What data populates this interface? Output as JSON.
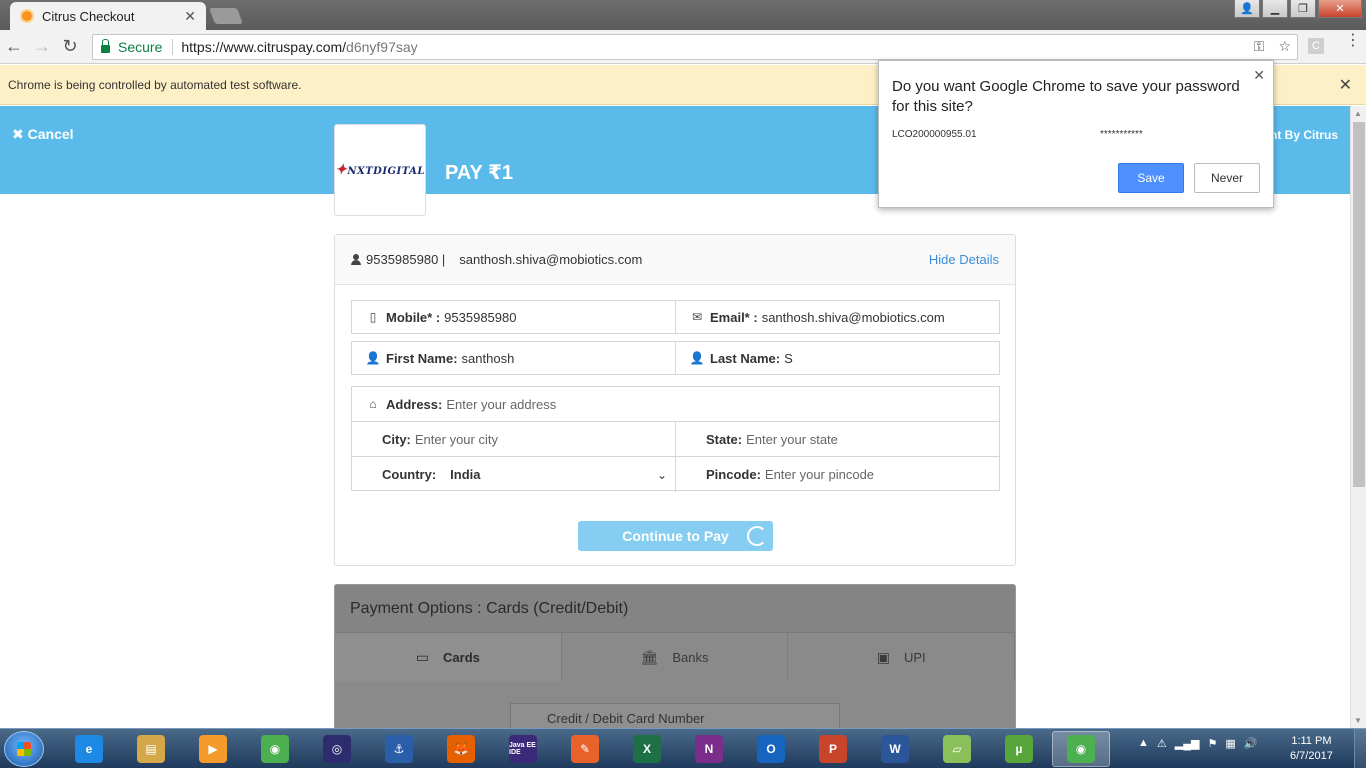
{
  "browser": {
    "tab_title": "Citrus Checkout",
    "tab_close": "✕",
    "secure_label": "Secure",
    "url_host": "https://www.citruspay.com/",
    "url_path": "d6nyf97say",
    "infobar_text": "Chrome is being controlled by automated test software.",
    "infobar_close": "✕",
    "ext_letter": "C"
  },
  "page": {
    "cancel_label": "✖ Cancel",
    "payment_by": "ent By Citrus",
    "logo_brand": "NXTDIGITAL",
    "pay_amount": "PAY ₹1"
  },
  "details": {
    "phone_head": "9535985980 |",
    "email_head": "santhosh.shiva@mobiotics.com",
    "hide_details": "Hide Details",
    "mobile_label": "Mobile* :",
    "mobile_value": "9535985980",
    "email_label": "Email* :",
    "email_value": "santhosh.shiva@mobiotics.com",
    "first_name_label": "First Name:",
    "first_name_value": "santhosh",
    "last_name_label": "Last Name:",
    "last_name_value": "S",
    "address_label": "Address:",
    "address_placeholder": "Enter your address",
    "city_label": "City:",
    "city_placeholder": "Enter your city",
    "state_label": "State:",
    "state_placeholder": "Enter your state",
    "country_label": "Country:",
    "country_value": "India",
    "pincode_label": "Pincode:",
    "pincode_placeholder": "Enter your pincode",
    "continue_label": "Continue to Pay"
  },
  "payment_options": {
    "header": "Payment Options : Cards (Credit/Debit)",
    "tabs": [
      {
        "label": "Cards"
      },
      {
        "label": "Banks"
      },
      {
        "label": "UPI"
      }
    ],
    "card_number_placeholder": "Credit / Debit Card Number"
  },
  "password_popup": {
    "question": "Do you want Google Chrome to save your password for this site?",
    "username": "LCO200000955.01",
    "password": "***********",
    "save_label": "Save",
    "never_label": "Never"
  },
  "taskbar": {
    "items": [
      {
        "label": "e",
        "color": "#1e88e5"
      },
      {
        "label": "▤",
        "color": "#d4a84a"
      },
      {
        "label": "▶",
        "color": "#f59b2b"
      },
      {
        "label": "◉",
        "color": "#4caf50"
      },
      {
        "label": "◎",
        "color": "#2c2c6e"
      },
      {
        "label": "⚓",
        "color": "#2b5ea8"
      },
      {
        "label": "🦊",
        "color": "#e66000"
      },
      {
        "label": "Java EE IDE",
        "color": "#3b2a7a"
      },
      {
        "label": "✎",
        "color": "#e8622c"
      },
      {
        "label": "X",
        "color": "#1d7044"
      },
      {
        "label": "N",
        "color": "#7b2d8b"
      },
      {
        "label": "O",
        "color": "#1565c0"
      },
      {
        "label": "P",
        "color": "#c8442b"
      },
      {
        "label": "W",
        "color": "#2b579a"
      },
      {
        "label": "▱",
        "color": "#8bbf5a"
      },
      {
        "label": "µ",
        "color": "#57a53b"
      },
      {
        "label": "◉",
        "color": "#4caf50"
      }
    ],
    "time": "1:11 PM",
    "date": "6/7/2017"
  }
}
